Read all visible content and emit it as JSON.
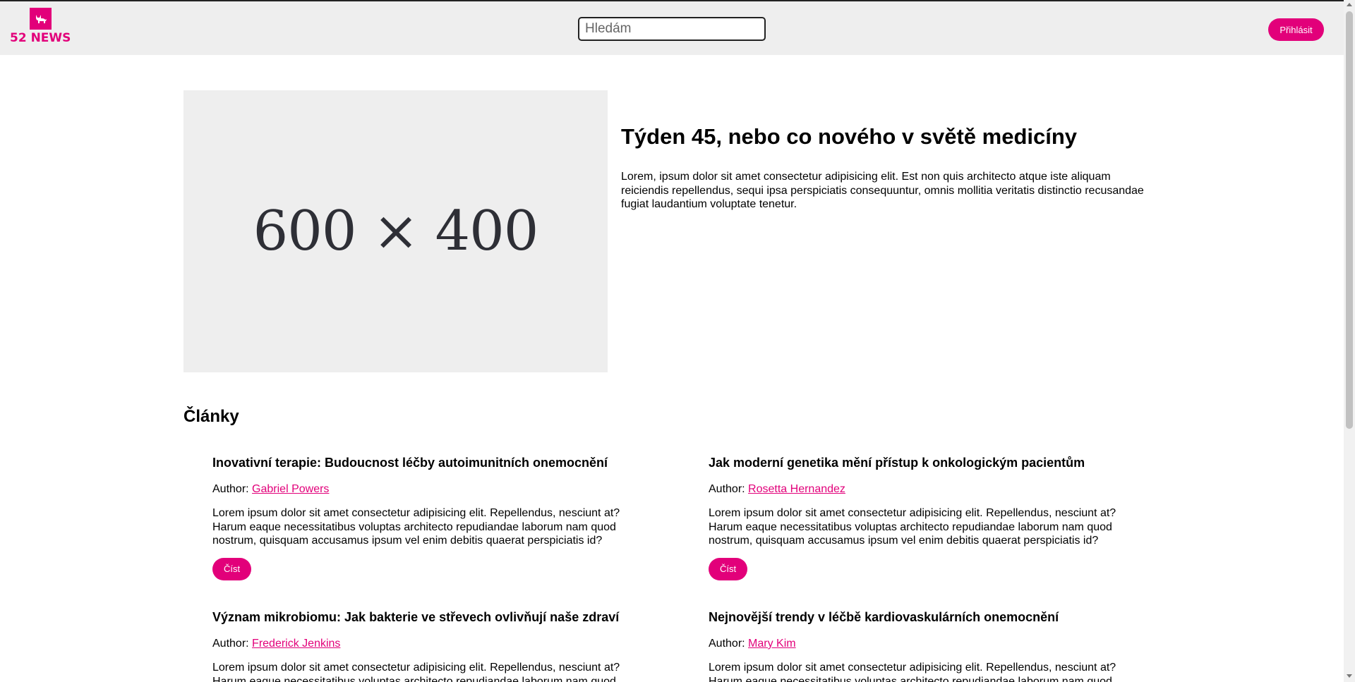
{
  "header": {
    "logo_text": "52 NEWS",
    "search_placeholder": "Hledám",
    "login_label": "Přihlásit"
  },
  "hero": {
    "image_text": "600 × 400",
    "title": "Týden 45, nebo co nového v světě medicíny",
    "text": "Lorem, ipsum dolor sit amet consectetur adipisicing elit. Est non quis architecto atque iste aliquam reiciendis repellendus, sequi ipsa perspiciatis consequuntur, omnis mollitia veritatis distinctio recusandae fugiat laudantium voluptate tenetur."
  },
  "articles_section": {
    "title": "Články",
    "author_prefix": "Author:",
    "read_label": "Číst",
    "items": [
      {
        "title": "Inovativní terapie: Budoucnost léčby autoimunitních onemocnění",
        "author": "Gabriel Powers",
        "excerpt": "Lorem ipsum dolor sit amet consectetur adipisicing elit. Repellendus, nesciunt at? Harum eaque necessitatibus voluptas architecto repudiandae laborum nam quod nostrum, quisquam accusamus ipsum vel enim debitis quaerat perspiciatis id?"
      },
      {
        "title": "Jak moderní genetika mění přístup k onkologickým pacientům",
        "author": "Rosetta Hernandez",
        "excerpt": "Lorem ipsum dolor sit amet consectetur adipisicing elit. Repellendus, nesciunt at? Harum eaque necessitatibus voluptas architecto repudiandae laborum nam quod nostrum, quisquam accusamus ipsum vel enim debitis quaerat perspiciatis id?"
      },
      {
        "title": "Význam mikrobiomu: Jak bakterie ve střevech ovlivňují naše zdraví",
        "author": "Frederick Jenkins",
        "excerpt": "Lorem ipsum dolor sit amet consectetur adipisicing elit. Repellendus, nesciunt at? Harum eaque necessitatibus voluptas architecto repudiandae laborum nam quod nostrum, quisquam accusamus ipsum vel enim debitis quaerat perspiciatis id?"
      },
      {
        "title": "Nejnovější trendy v léčbě kardiovaskulárních onemocnění",
        "author": "Mary Kim",
        "excerpt": "Lorem ipsum dolor sit amet consectetur adipisicing elit. Repellendus, nesciunt at? Harum eaque necessitatibus voluptas architecto repudiandae laborum nam quod nostrum, quisquam accusamus ipsum vel enim debitis quaerat perspiciatis id?"
      }
    ]
  },
  "colors": {
    "accent": "#e2007a",
    "header_bg": "#eeeeee",
    "placeholder_bg": "#eeeeee"
  },
  "icons": {
    "logo_icon": "cat-icon"
  }
}
